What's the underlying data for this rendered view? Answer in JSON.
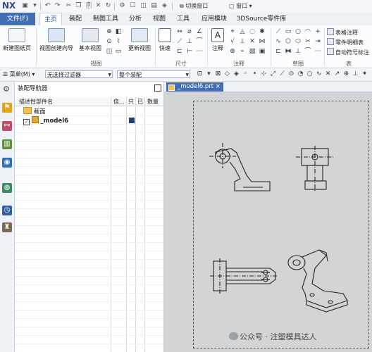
{
  "titlebar": {
    "app": "NX",
    "switch_window": "切换窗口",
    "window": "窗口"
  },
  "tabs": [
    "文件(F)",
    "主页",
    "装配",
    "制图工具",
    "分析",
    "视图",
    "工具",
    "应用模块",
    "3DSource零件库"
  ],
  "ribbon": {
    "new_sheet": "新建图纸页",
    "view_wizard": "视图创建向导",
    "base_view": "基本视图",
    "update_view": "更新视图",
    "quick": "快速",
    "note": "注释",
    "table_note": "表格注释",
    "parts_list": "零件明细表",
    "auto_symbol": "自动符号标注",
    "groups": {
      "view": "视图",
      "dimension": "尺寸",
      "annotation": "注释",
      "sketch": "草图",
      "table": "表"
    }
  },
  "filterbar": {
    "menu": "菜单(M)",
    "filter": "无选择过滤器",
    "assembly": "整个装配"
  },
  "navigator": {
    "title": "装配导航器",
    "columns": [
      "描述性部件名",
      "信...",
      "只",
      "已",
      "数量"
    ],
    "rows": [
      "截面",
      "_model6"
    ]
  },
  "graphics": {
    "tab": "_model6.prt"
  },
  "watermark": "公众号 · 注塑模具达人",
  "colors": {
    "file_tab": "#3f70b6",
    "canvas": "#d2d4d6"
  }
}
